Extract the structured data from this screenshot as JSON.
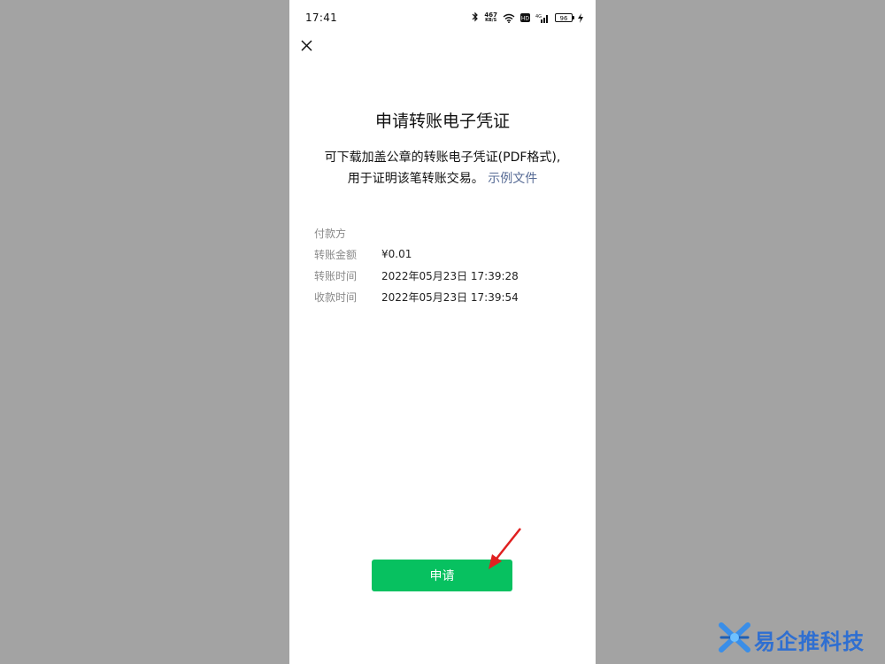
{
  "status_bar": {
    "time": "17:41",
    "net_speed_value": "467",
    "net_speed_unit": "KB/S",
    "hd_label": "HD",
    "network_type": "4G",
    "battery_percent": "96"
  },
  "page": {
    "title": "申请转账电子凭证",
    "description_line1": "可下载加盖公章的转账电子凭证(PDF格式),",
    "description_line2": "用于证明该笔转账交易。",
    "sample_link": "示例文件"
  },
  "info_rows": [
    {
      "label": "付款方",
      "value": ""
    },
    {
      "label": "转账金额",
      "value": "¥0.01"
    },
    {
      "label": "转账时间",
      "value": "2022年05月23日 17:39:28"
    },
    {
      "label": "收款时间",
      "value": "2022年05月23日 17:39:54"
    }
  ],
  "apply_button": {
    "label": "申请"
  },
  "watermark": {
    "text": "易企推科技"
  },
  "colors": {
    "accent_green": "#07c160",
    "link_blue": "#576b95",
    "annotation_arrow": "#e02020",
    "backdrop_gray": "#a3a3a3"
  },
  "icons": [
    "close-icon",
    "bluetooth-icon",
    "wifi-icon",
    "hd-icon",
    "signal-icon",
    "battery-icon",
    "charging-icon",
    "logo-icon"
  ]
}
